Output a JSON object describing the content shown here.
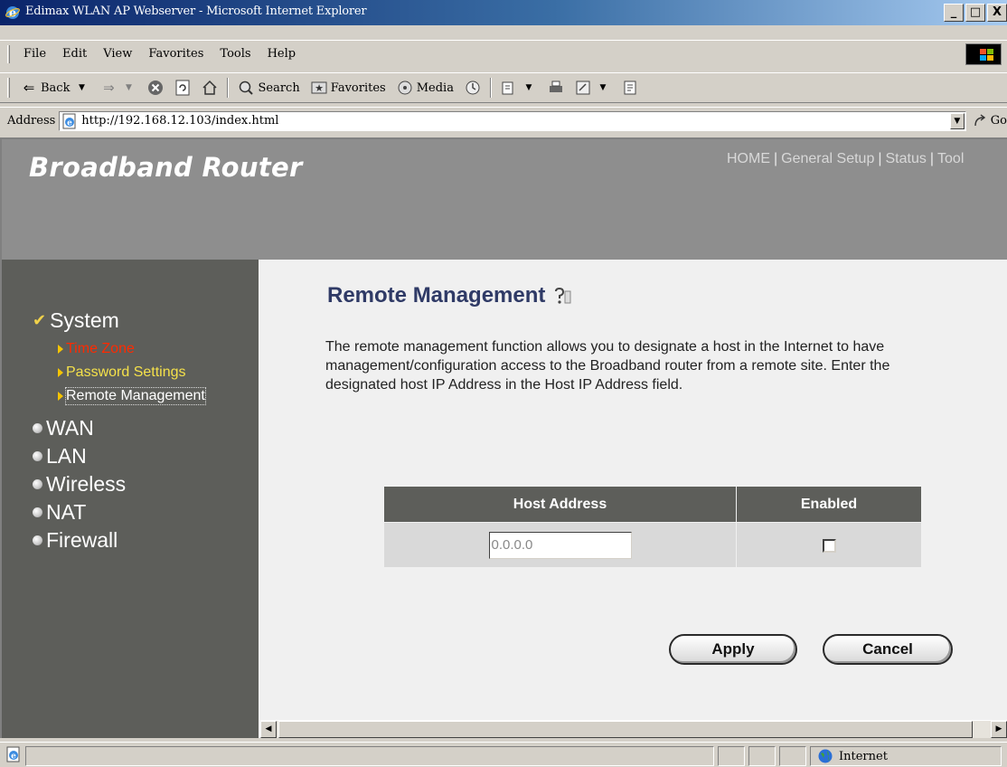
{
  "window": {
    "title": "Edimax WLAN AP Webserver - Microsoft Internet Explorer",
    "controls": {
      "minimize": "_",
      "maximize": "□",
      "close": "X"
    }
  },
  "menubar": {
    "items": [
      "File",
      "Edit",
      "View",
      "Favorites",
      "Tools",
      "Help"
    ]
  },
  "toolbar": {
    "back_label": "Back",
    "search_label": "Search",
    "favorites_label": "Favorites",
    "media_label": "Media"
  },
  "address": {
    "label": "Address",
    "url": "http://192.168.12.103/index.html",
    "go_label": "Go"
  },
  "header": {
    "brand": "Broadband Router",
    "nav": [
      "HOME",
      "General Setup",
      "Status",
      "Tool"
    ]
  },
  "sidebar": {
    "system": "System",
    "sub_items": [
      "Time Zone",
      "Password Settings",
      "Remote Management"
    ],
    "main_items": [
      "WAN",
      "LAN",
      "Wireless",
      "NAT",
      "Firewall"
    ]
  },
  "content": {
    "title": "Remote Management",
    "description": "The remote management function allows you to designate a host in the Internet to have management/configuration access to the Broadband router from a remote site. Enter the designated host IP Address in the Host IP Address field.",
    "table": {
      "headers": [
        "Host Address",
        "Enabled"
      ],
      "host_address_value": "0.0.0.0",
      "enabled": false
    },
    "apply_label": "Apply",
    "cancel_label": "Cancel"
  },
  "statusbar": {
    "zone": "Internet"
  },
  "colors": {
    "sidebar_bg": "#5d5e5a",
    "header_bg": "#8e8e8e",
    "content_bg": "#f0f0f0",
    "title_color": "#2f3a66",
    "active_sub_red": "#ff2a00",
    "sub_yellow": "#f5e14a"
  }
}
